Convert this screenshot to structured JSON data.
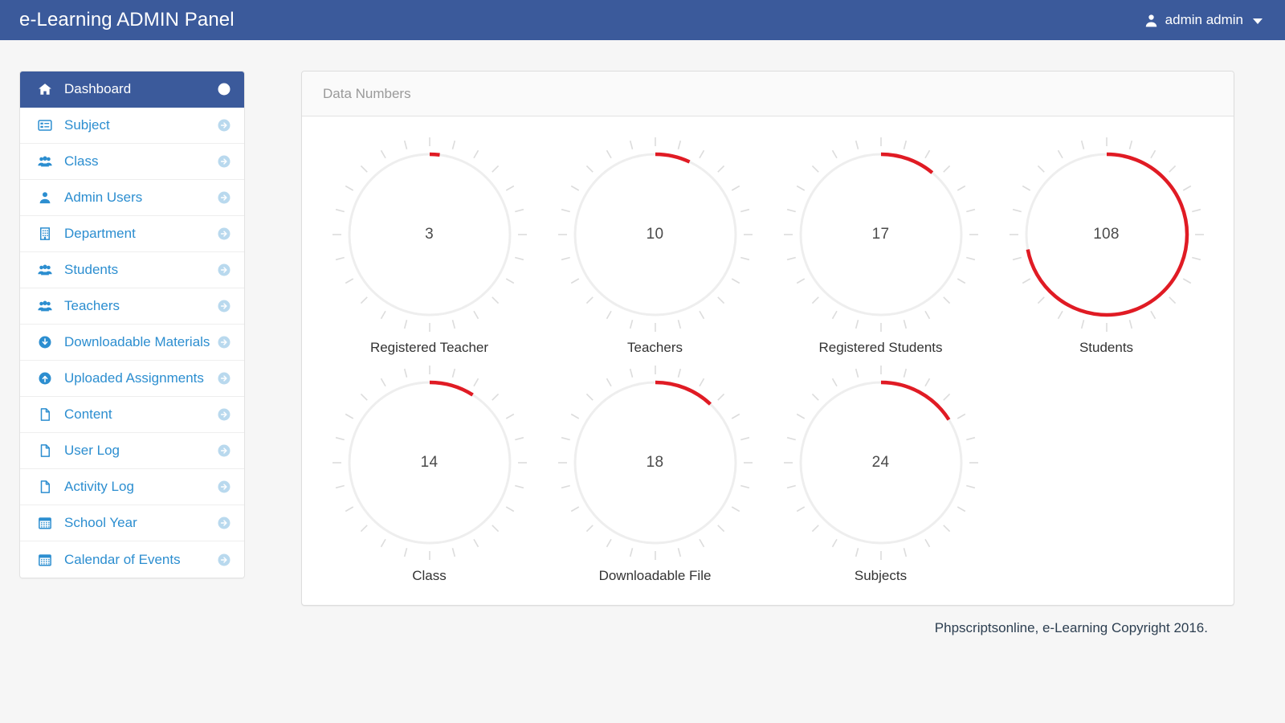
{
  "header": {
    "brand": "e-Learning ADMIN Panel",
    "user_name": "admin admin",
    "user_icon": "user-icon",
    "caret_icon": "caret-down-icon",
    "background_color": "#3b5a9b"
  },
  "sidebar": {
    "items": [
      {
        "label": "Dashboard",
        "icon": "home-icon",
        "active": true
      },
      {
        "label": "Subject",
        "icon": "list-alt-icon",
        "active": false
      },
      {
        "label": "Class",
        "icon": "group-icon",
        "active": false
      },
      {
        "label": "Admin Users",
        "icon": "user-icon",
        "active": false
      },
      {
        "label": "Department",
        "icon": "building-icon",
        "active": false
      },
      {
        "label": "Students",
        "icon": "group-icon",
        "active": false
      },
      {
        "label": "Teachers",
        "icon": "group-icon",
        "active": false
      },
      {
        "label": "Downloadable Materials",
        "icon": "arrow-down-circle-icon",
        "active": false
      },
      {
        "label": "Uploaded Assignments",
        "icon": "arrow-up-circle-icon",
        "active": false
      },
      {
        "label": "Content",
        "icon": "file-icon",
        "active": false
      },
      {
        "label": "User Log",
        "icon": "file-icon",
        "active": false
      },
      {
        "label": "Activity Log",
        "icon": "file-icon",
        "active": false
      },
      {
        "label": "School Year",
        "icon": "calendar-icon",
        "active": false
      },
      {
        "label": "Calendar of Events",
        "icon": "calendar-icon",
        "active": false
      }
    ],
    "item_arrow_icon": "arrow-right-circle-icon",
    "link_color": "#2c8ed0",
    "active_background": "#3b5a9b"
  },
  "panel": {
    "title": "Data Numbers"
  },
  "chart_data": {
    "type": "gauge",
    "title": "Data Numbers",
    "accent_color": "#e01b24",
    "track_color": "#eeeeee",
    "tick_color": "#dcdcdc",
    "max_value": 150,
    "ticks": 24,
    "start_angle_deg": 0,
    "direction": "clockwise",
    "gauges": [
      {
        "label": "Registered Teacher",
        "value": 3,
        "percent": 2
      },
      {
        "label": "Teachers",
        "value": 10,
        "percent": 7
      },
      {
        "label": "Registered Students",
        "value": 17,
        "percent": 11
      },
      {
        "label": "Students",
        "value": 108,
        "percent": 72
      },
      {
        "label": "Class",
        "value": 14,
        "percent": 9
      },
      {
        "label": "Downloadable File",
        "value": 18,
        "percent": 12
      },
      {
        "label": "Subjects",
        "value": 24,
        "percent": 16
      }
    ]
  },
  "footer": {
    "copyright": "Phpscriptsonline, e-Learning Copyright 2016."
  }
}
